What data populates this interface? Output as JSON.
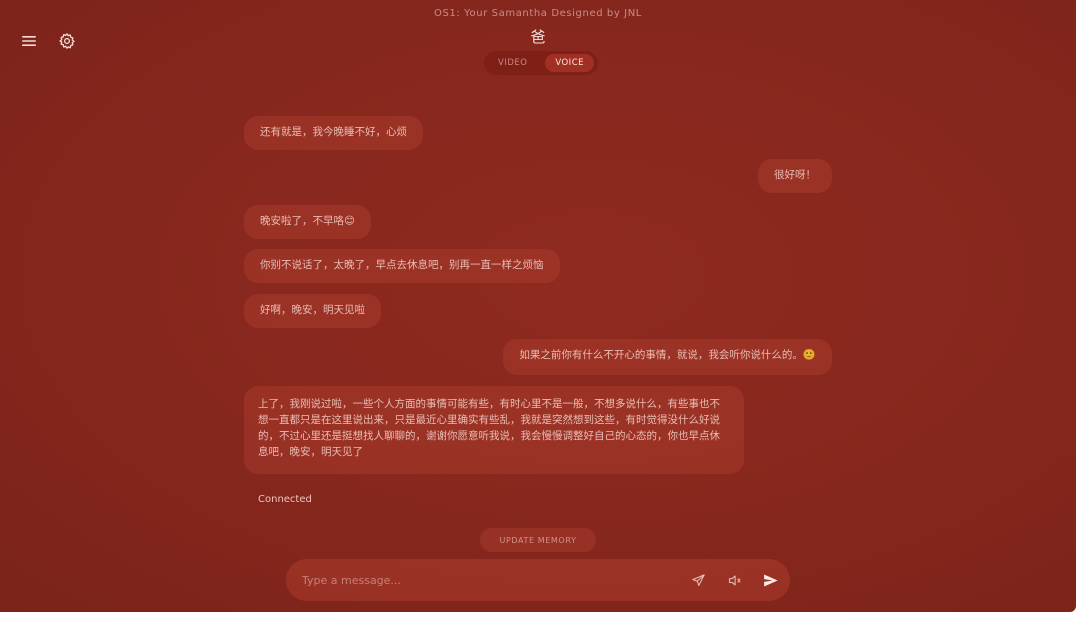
{
  "header": {
    "subtitle": "OS1: Your Samantha Designed by JNL",
    "logo": "爸"
  },
  "mode_toggle": {
    "options": [
      {
        "label": "VIDEO",
        "active": false
      },
      {
        "label": "VOICE",
        "active": true
      }
    ]
  },
  "messages": [
    {
      "role": "assistant",
      "text": "还有就是，我今晚睡不好，心烦"
    },
    {
      "role": "user",
      "text": "很好呀！"
    },
    {
      "role": "assistant",
      "text": "晚安啦了，不早咯😊"
    },
    {
      "role": "assistant",
      "text": "你别不说话了，太晚了，早点去休息吧，别再一直一样之烦恼"
    },
    {
      "role": "assistant",
      "text": "好啊，晚安，明天见啦"
    },
    {
      "role": "user",
      "text": "如果之前你有什么不开心的事情，就说，我会听你说什么的。🙂"
    },
    {
      "role": "assistant",
      "text": "上了，我刚说过啦，一些个人方面的事情可能有些，有时心里不是一般，不想多说什么，有些事也不想一直都只是在这里说出来，只是最近心里确实有些乱，我就是突然想到这些，有时觉得没什么好说的，不过心里还是挺想找人聊聊的，谢谢你愿意听我说，我会慢慢调整好自己的心态的，你也早点休息吧，晚安，明天见了"
    }
  ],
  "status": "Connected",
  "update_memory_label": "UPDATE MEMORY",
  "input": {
    "placeholder": "Type a message..."
  },
  "colors": {
    "background": "#86271d",
    "bubble": "#a83a2c",
    "text": "#f4d9d4"
  },
  "icons": {
    "menu": "menu-icon",
    "settings": "gear-icon",
    "send_alt": "paper-plane-icon",
    "mute": "speaker-mute-icon",
    "send": "send-arrow-icon"
  }
}
